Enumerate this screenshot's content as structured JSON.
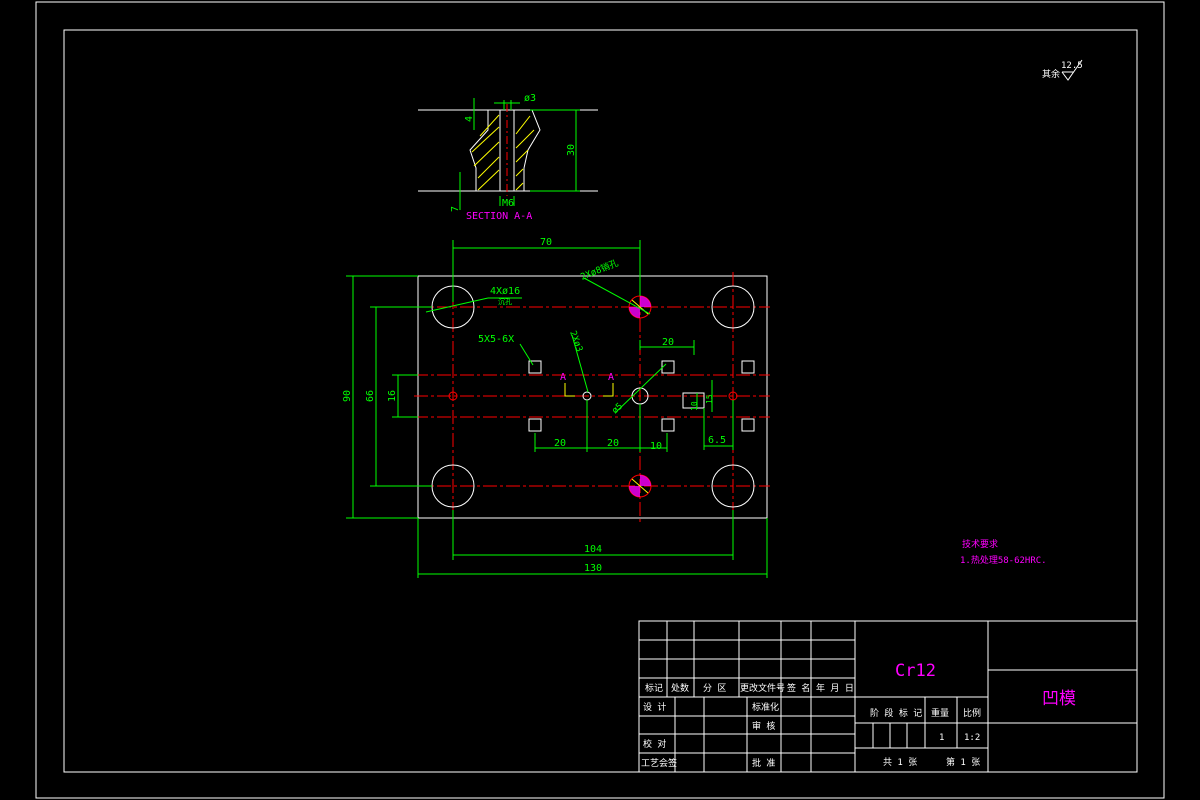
{
  "drawing": {
    "roughness_symbol": {
      "label": "其余",
      "value": "12.5"
    },
    "section": {
      "title": "SECTION A-A",
      "dim_top": "ø3",
      "dim_height": "30",
      "dim_left_top": "4",
      "dim_left_bottom": "7",
      "dim_bottom": "M6"
    },
    "plan": {
      "dim_70": "70",
      "dim_90": "90",
      "dim_66": "66",
      "dim_16": "16",
      "dim_104": "104",
      "dim_130": "130",
      "dim_20_top": "20",
      "dim_20_a": "20",
      "dim_20_b": "20",
      "dim_10_bottom": "10",
      "dim_6_5": "6.5",
      "dim_10_right": "10",
      "dim_15_right": "15",
      "note_holes": "4Xø16",
      "note_holes_sub": "沉孔",
      "note_pins": "2Xø8销孔",
      "note_squares": "5X5-6X",
      "note_small_holes": "2Xø3",
      "note_center_hole": "ø5",
      "section_marker": "A"
    },
    "tech_req": {
      "title": "技术要求",
      "line1": "1.热处理58-62HRC."
    }
  },
  "title_block": {
    "material": "Cr12",
    "part_name": "凹模",
    "col_headers": [
      "标记",
      "处数",
      "分 区",
      "更改文件号",
      "签 名",
      "年 月 日"
    ],
    "row_design": "设  计",
    "row_std": "标准化",
    "row_check": "校  对",
    "row_review": "审  核",
    "row_process": "工艺会签",
    "row_approve": "批  准",
    "stage_label": "阶 段 标 记",
    "weight_label": "重量",
    "scale_label": "比例",
    "weight_value": "1",
    "scale_value": "1:2",
    "sheets_total": "共 1 张",
    "sheet_no": "第 1 张"
  },
  "colors": {
    "outline": "#ffffff",
    "dimension": "#00ff00",
    "center": "#ff0000",
    "annotation": "#ff00ff",
    "hatch": "#ffff00"
  }
}
